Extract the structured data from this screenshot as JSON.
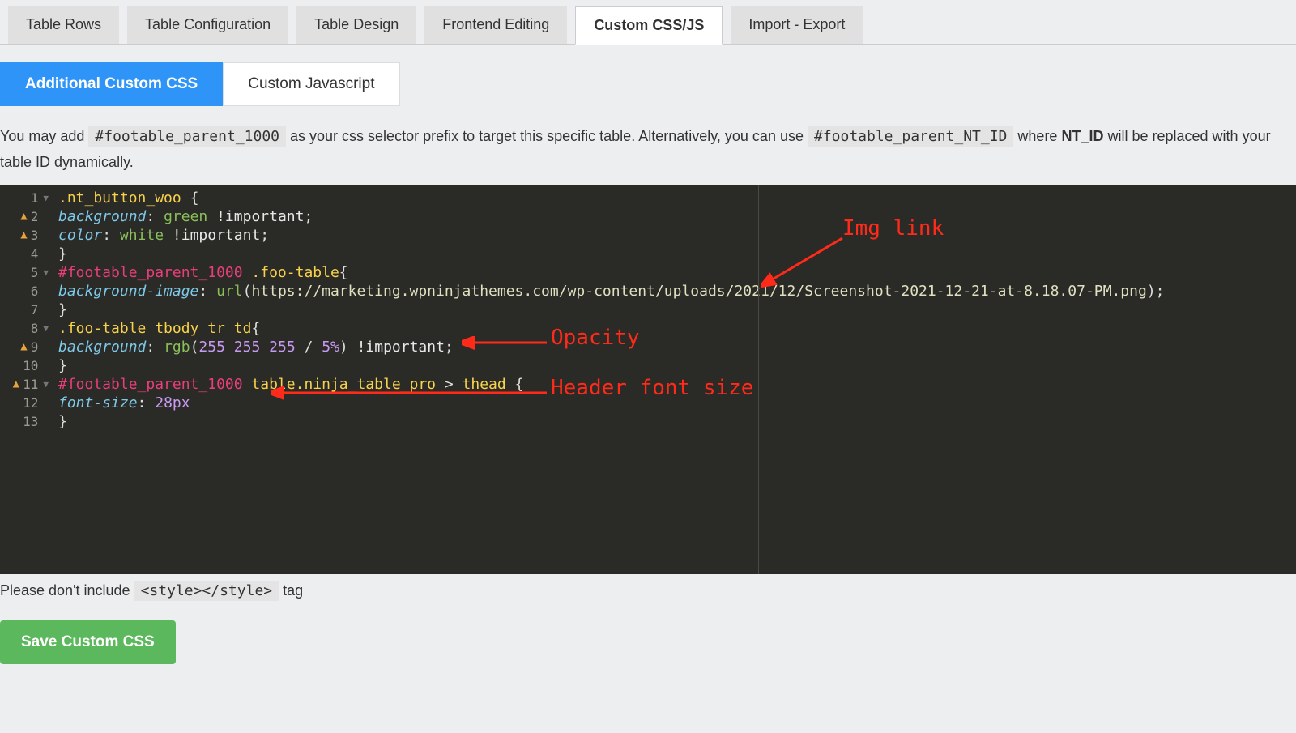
{
  "tabs": {
    "items": [
      {
        "label": "Table Rows",
        "active": false
      },
      {
        "label": "Table Configuration",
        "active": false
      },
      {
        "label": "Table Design",
        "active": false
      },
      {
        "label": "Frontend Editing",
        "active": false
      },
      {
        "label": "Custom CSS/JS",
        "active": true
      },
      {
        "label": "Import - Export",
        "active": false
      }
    ]
  },
  "sub_tabs": {
    "items": [
      {
        "label": "Additional Custom CSS",
        "active": true
      },
      {
        "label": "Custom Javascript",
        "active": false
      }
    ]
  },
  "help": {
    "pre": "You may add ",
    "code1": "#footable_parent_1000",
    "mid": " as your css selector prefix to target this specific table. Alternatively, you can use ",
    "code2": "#footable_parent_NT_ID",
    "post1": " where ",
    "bold": "NT_ID",
    "post2": " will be replaced with your table ID dynamically."
  },
  "editor": {
    "lines": [
      {
        "n": 1,
        "warn": false,
        "fold": true,
        "html": "<span class='c-sel'>.nt_button_woo</span> <span class='c-punc'>{</span>"
      },
      {
        "n": 2,
        "warn": true,
        "fold": false,
        "html": "<span class='c-prop'>background</span><span class='c-punc'>:</span> <span class='c-val'>green</span> <span class='c-imp'>!important</span><span class='c-punc'>;</span>"
      },
      {
        "n": 3,
        "warn": true,
        "fold": false,
        "html": "<span class='c-prop'>color</span><span class='c-punc'>:</span> <span class='c-val'>white</span> <span class='c-imp'>!important</span><span class='c-punc'>;</span>"
      },
      {
        "n": 4,
        "warn": false,
        "fold": false,
        "html": "<span class='c-punc'>}</span>"
      },
      {
        "n": 5,
        "warn": false,
        "fold": true,
        "html": "<span class='c-id'>#footable_parent_1000</span> <span class='c-sel'>.foo-table</span><span class='c-punc'>{</span>"
      },
      {
        "n": 6,
        "warn": false,
        "fold": false,
        "html": "<span class='c-prop'>background-image</span><span class='c-punc'>:</span> <span class='c-val'>url</span><span class='c-punc'>(</span><span class='c-url'>https://marketing.wpninjathemes.com/wp-content/uploads/2021/12/Screenshot-2021-12-21-at-8.18.07-PM.png</span><span class='c-punc'>);</span>"
      },
      {
        "n": 7,
        "warn": false,
        "fold": false,
        "html": "<span class='c-punc'>}</span>"
      },
      {
        "n": 8,
        "warn": false,
        "fold": true,
        "html": "<span class='c-sel'>.foo-table</span> <span class='c-sel'>tbody</span> <span class='c-sel'>tr</span> <span class='c-sel'>td</span><span class='c-punc'>{</span>"
      },
      {
        "n": 9,
        "warn": true,
        "fold": false,
        "html": "<span class='c-prop'>background</span><span class='c-punc'>:</span> <span class='c-val'>rgb</span><span class='c-punc'>(</span><span class='c-num'>255</span> <span class='c-num'>255</span> <span class='c-num'>255</span> <span class='c-punc'>/</span> <span class='c-num'>5%</span><span class='c-punc'>)</span> <span class='c-imp'>!important</span><span class='c-punc'>;</span>"
      },
      {
        "n": 10,
        "warn": false,
        "fold": false,
        "html": "<span class='c-punc'>}</span>"
      },
      {
        "n": 11,
        "warn": true,
        "fold": true,
        "html": "<span class='c-id'>#footable_parent_1000</span> <span class='c-sel'>table</span><span class='c-sel'>.ninja_table_pro</span> <span class='c-punc'>&gt;</span> <span class='c-sel'>thead</span> <span class='c-punc'>{</span>"
      },
      {
        "n": 12,
        "warn": false,
        "fold": false,
        "html": "<span class='c-prop'>font-size</span><span class='c-punc'>:</span> <span class='c-num'>28px</span>"
      },
      {
        "n": 13,
        "warn": false,
        "fold": false,
        "html": "<span class='c-punc'>}</span>"
      }
    ],
    "css_text": ".nt_button_woo {\nbackground: green !important;\ncolor: white !important;\n}\n#footable_parent_1000 .foo-table{\nbackground-image: url(https://marketing.wpninjathemes.com/wp-content/uploads/2021/12/Screenshot-2021-12-21-at-8.18.07-PM.png);\n}\n.foo-table tbody tr td{\nbackground: rgb(255 255 255 / 5%) !important;\n}\n#footable_parent_1000 table.ninja_table_pro > thead {\nfont-size: 28px\n}"
  },
  "annotations": {
    "img_link": "Img link",
    "opacity": "Opacity",
    "header_font": "Header font size"
  },
  "footnote": {
    "pre": "Please don't include ",
    "code": "<style></style>",
    "post": " tag"
  },
  "buttons": {
    "save": "Save Custom CSS"
  }
}
